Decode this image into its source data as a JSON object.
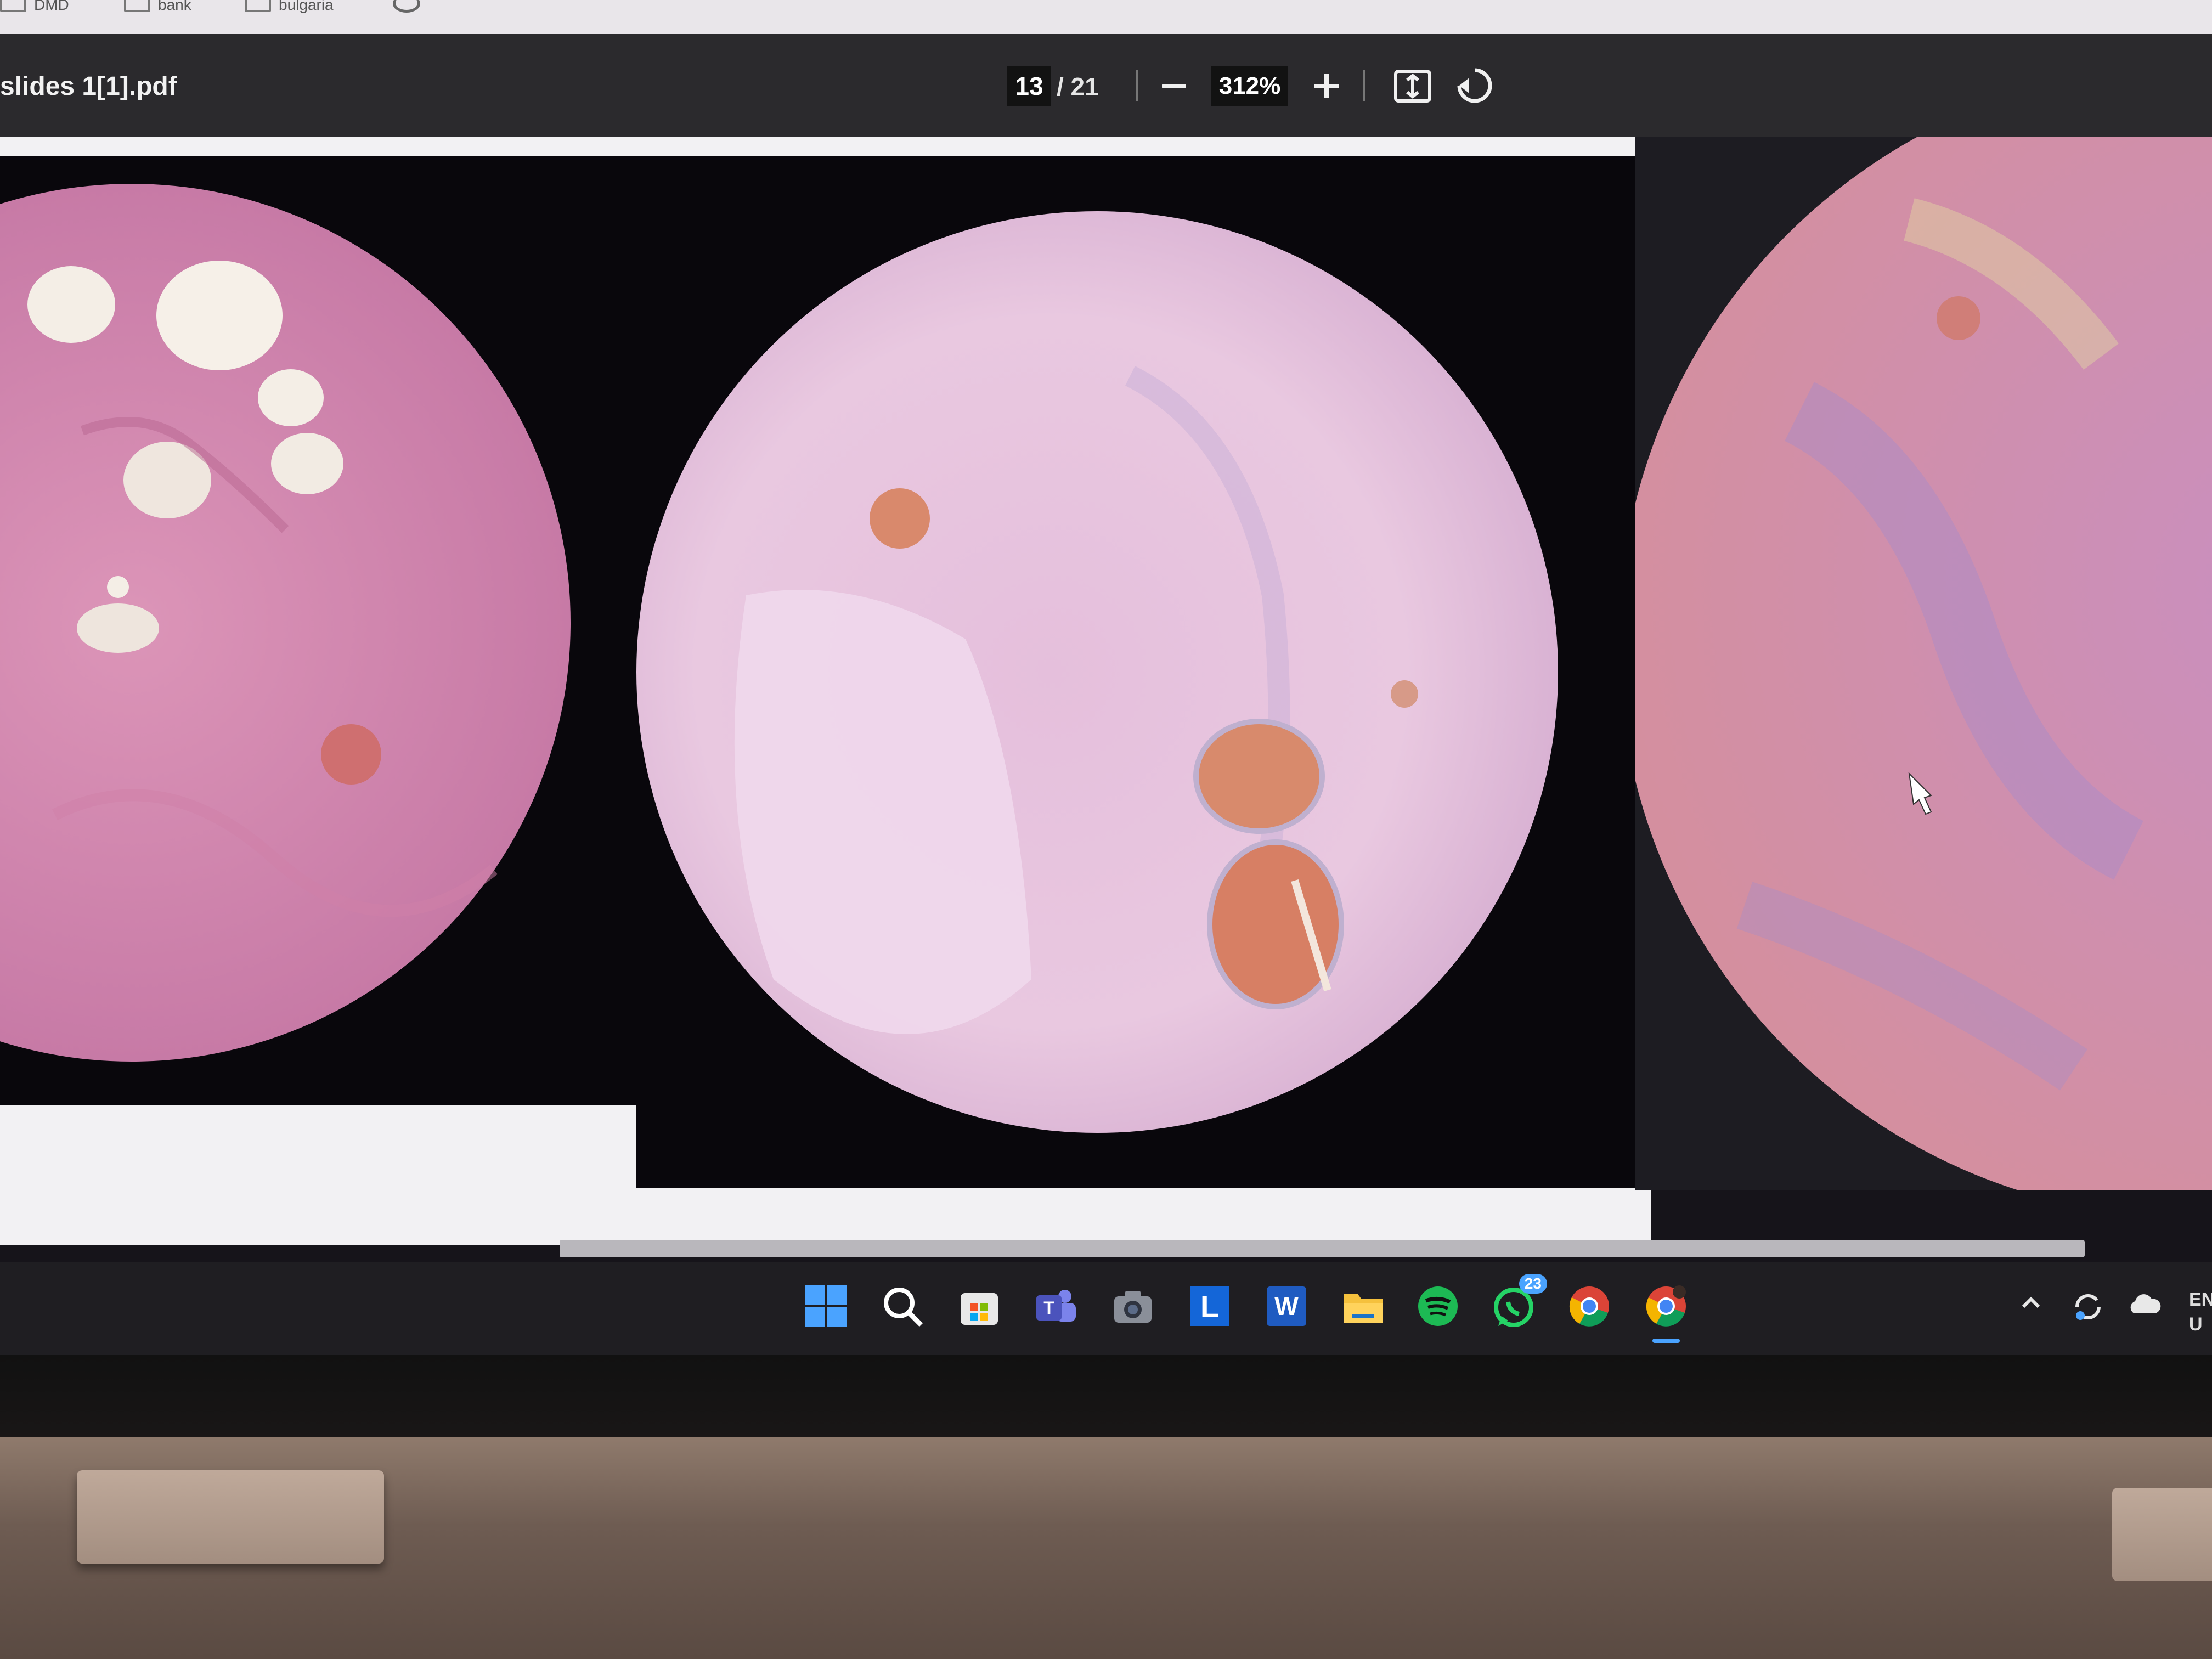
{
  "bookmarks_bar": {
    "items": [
      {
        "label": "DMD",
        "icon": "folder-icon"
      },
      {
        "label": "bank",
        "icon": "folder-icon"
      },
      {
        "label": "bulgaria",
        "icon": "folder-icon"
      }
    ]
  },
  "pdf_viewer": {
    "file_name": "slides 1[1].pdf",
    "current_page": "13",
    "total_pages": "/ 21",
    "zoom": "312%",
    "icons": {
      "zoom_out": "minus-icon",
      "zoom_in": "plus-icon",
      "fit_page": "fit-to-page-icon",
      "rotate": "rotate-icon"
    }
  },
  "page_images": [
    {
      "description": "micrograph-left",
      "colors": {
        "tissue": "#d78fb2",
        "vessel": "#c96f6b"
      }
    },
    {
      "description": "micrograph-center",
      "colors": {
        "tissue": "#e7c2dd",
        "vessel": "#cf7a64"
      }
    },
    {
      "description": "micrograph-right",
      "colors": {
        "tissue": "#d490b0",
        "stain": "#a78cc9"
      }
    }
  ],
  "taskbar": {
    "apps": [
      {
        "name": "windows-start-icon"
      },
      {
        "name": "search-icon"
      },
      {
        "name": "microsoft-store-icon"
      },
      {
        "name": "teams-icon"
      },
      {
        "name": "camera-icon"
      },
      {
        "name": "l-app-icon",
        "letter": "L"
      },
      {
        "name": "word-icon",
        "letter": "W"
      },
      {
        "name": "file-explorer-icon"
      },
      {
        "name": "spotify-icon"
      },
      {
        "name": "whatsapp-icon",
        "badge": "23"
      },
      {
        "name": "chrome-icon"
      },
      {
        "name": "chrome-profile-icon"
      }
    ],
    "tray": {
      "language_top": "EN",
      "language_bottom": "U"
    }
  },
  "colors": {
    "toolbar": "#2b2a2d",
    "taskbar": "#1f1e22",
    "accent": "#4aa3ff",
    "spotify": "#1db954",
    "whatsapp": "#25d366"
  }
}
